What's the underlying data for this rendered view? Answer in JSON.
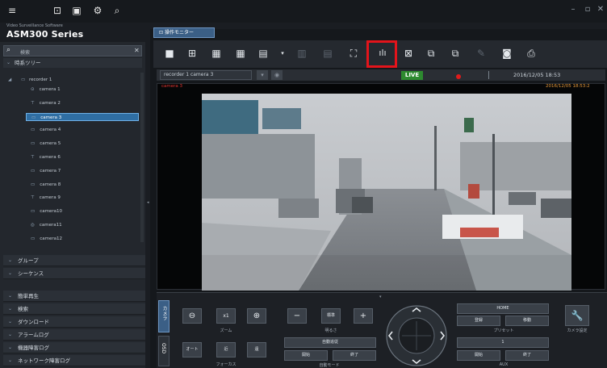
{
  "app": {
    "brand_subtitle": "Video Surveillance Software",
    "brand_title": "ASM300 Series"
  },
  "sidebar": {
    "search_placeholder": "検索",
    "tree_header": "時系ツリー",
    "recorder": "recorder 1",
    "cameras": [
      "camera 1",
      "camera 2",
      "camera 3",
      "camera 4",
      "camera 5",
      "camera 6",
      "camera 7",
      "camera 8",
      "camera 9",
      "camera10",
      "camera11",
      "camera12"
    ],
    "selected_index": 2,
    "sections_top": [
      "グループ",
      "シーケンス"
    ],
    "sections_bottom": [
      "簡単再生",
      "検索",
      "ダウンロード",
      "アラームログ",
      "機器障害ログ",
      "ネットワーク障害ログ"
    ]
  },
  "main": {
    "tab_label": "操作モニター",
    "camera_select": "recorder 1 camera 3",
    "live_label": "LIVE",
    "datetime": "2016/12/05 18:53",
    "cam_overlay_label": "camera 3",
    "cam_overlay_time": "2016/12/05 18:53:2"
  },
  "controls": {
    "tab_camera": "カメラ",
    "tab_osd": "OSD",
    "zoom_caption": "ズーム",
    "zoom_x1": "x1",
    "focus_auto": "オート",
    "focus_near": "近",
    "focus_far": "遠",
    "focus_caption": "フォーカス",
    "bright_std": "標準",
    "bright_caption": "明るさ",
    "color_mode": "自動追従",
    "start": "開始",
    "end": "終了",
    "auto_mode_caption": "自動モード",
    "preset_home": "HOME",
    "preset_register": "登録",
    "preset_move": "移動",
    "preset_caption": "プリセット",
    "aux_value": "1",
    "aux_caption": "AUX",
    "camera_settings": "カメラ設定"
  }
}
